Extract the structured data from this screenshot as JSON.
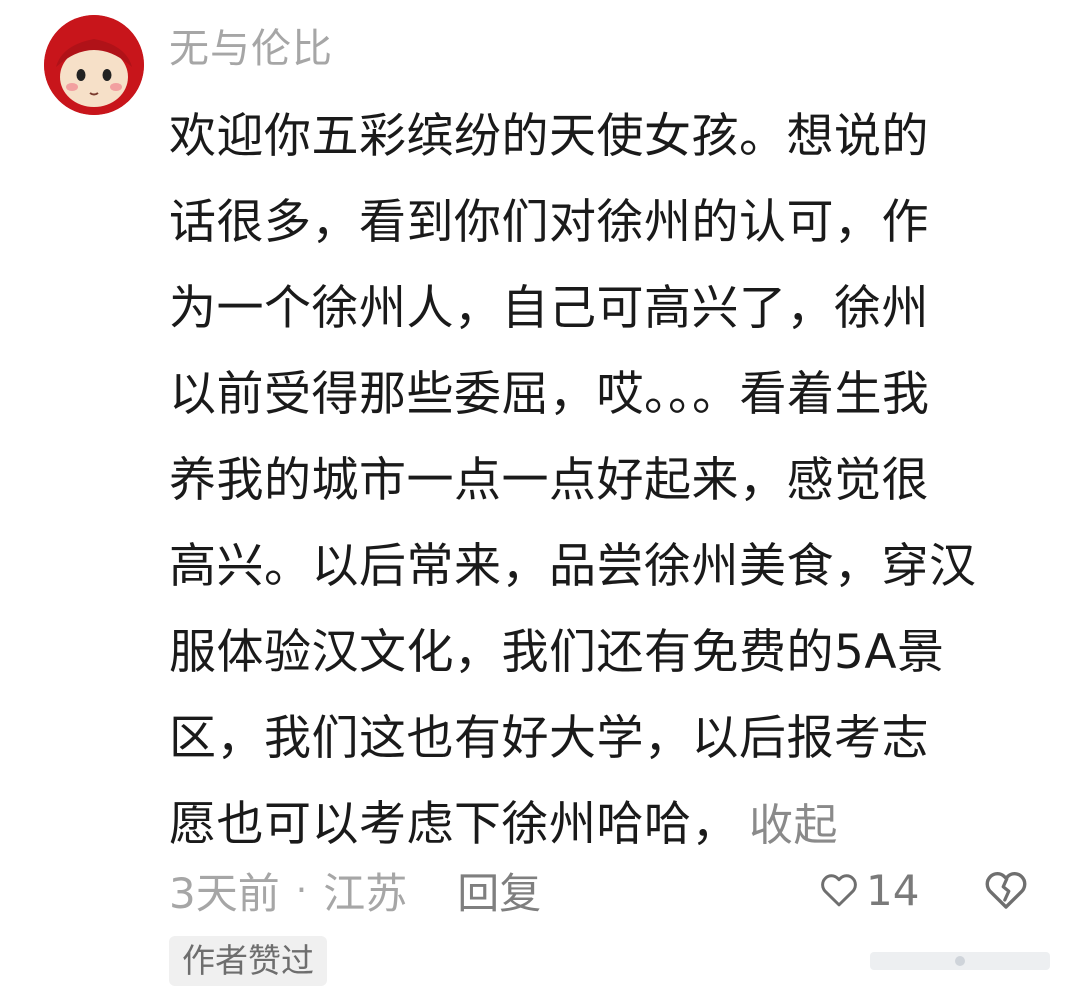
{
  "comment": {
    "username": "无与伦比",
    "text_lines": [
      "欢迎你五彩缤纷的天使女孩。想说的",
      "话很多，看到你们对徐州的认可，作",
      "为一个徐州人，自己可高兴了，徐州",
      "以前受得那些委屈，哎。。。看着生我",
      "养我的城市一点一点好起来，感觉很",
      "高兴。以后常来，品尝徐州美食，穿汉",
      "服体验汉文化，我们还有免费的5A景",
      "区，我们这也有好大学，以后报考志",
      "愿也可以考虑下徐州哈哈，"
    ],
    "collapse_label": "收起",
    "time": "3天前",
    "separator": "·",
    "location": "江苏",
    "reply_label": "回复",
    "like_count": "14",
    "author_badge": "作者赞过"
  },
  "icons": {
    "like": "heart-outline-icon",
    "dislike": "broken-heart-icon"
  },
  "colors": {
    "avatar_background": "#c8151b",
    "text": "#1a1a1a",
    "meta_gray": "#a6a6a6"
  }
}
